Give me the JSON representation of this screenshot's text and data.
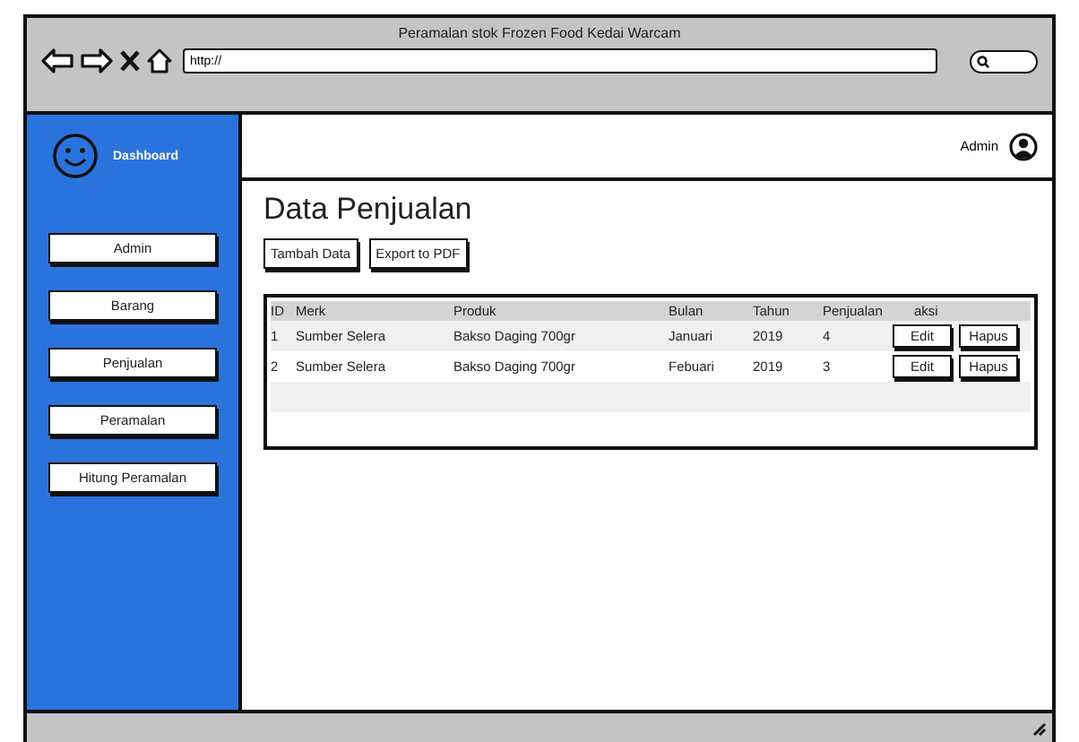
{
  "window": {
    "title": "Peramalan stok Frozen Food Kedai Warcam"
  },
  "address_bar": {
    "value": "http://"
  },
  "sidebar": {
    "title": "Dashboard",
    "items": [
      {
        "label": "Admin"
      },
      {
        "label": "Barang"
      },
      {
        "label": "Penjualan"
      },
      {
        "label": "Peramalan"
      },
      {
        "label": "Hitung Peramalan"
      }
    ]
  },
  "header": {
    "user": "Admin"
  },
  "page": {
    "title": "Data Penjualan",
    "buttons": [
      "Tambah Data",
      "Export to PDF"
    ]
  },
  "table": {
    "columns": [
      "ID",
      "Merk",
      "Produk",
      "Bulan",
      "Tahun",
      "Penjualan",
      "aksi"
    ],
    "rows": [
      {
        "cells": [
          "1",
          "Sumber Selera",
          "Bakso Daging 700gr",
          "Januari",
          "2019",
          "4"
        ],
        "actions": [
          "Edit",
          "Hapus"
        ]
      },
      {
        "cells": [
          "2",
          "Sumber Selera",
          "Bakso Daging 700gr",
          "Febuari",
          "2019",
          "3"
        ],
        "actions": [
          "Edit",
          "Hapus"
        ]
      }
    ]
  }
}
